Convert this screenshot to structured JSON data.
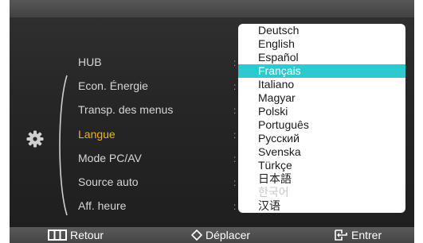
{
  "menu": {
    "items": [
      {
        "label": "HUB",
        "active": false
      },
      {
        "label": "Econ. Énergie",
        "active": false
      },
      {
        "label": "Transp. des menus",
        "active": false
      },
      {
        "label": "Langue",
        "active": true
      },
      {
        "label": "Mode PC/AV",
        "active": false
      },
      {
        "label": "Source auto",
        "active": false
      },
      {
        "label": "Aff. heure",
        "active": false
      }
    ],
    "separator": ":",
    "more_icon": "chevron-down-icon",
    "category_icon": "gear-icon"
  },
  "language_dropdown": {
    "selected": "Français",
    "options": [
      {
        "label": "Deutsch",
        "state": "normal"
      },
      {
        "label": "English",
        "state": "normal"
      },
      {
        "label": "Español",
        "state": "normal"
      },
      {
        "label": "Français",
        "state": "selected"
      },
      {
        "label": "Italiano",
        "state": "normal"
      },
      {
        "label": "Magyar",
        "state": "normal"
      },
      {
        "label": "Polski",
        "state": "normal"
      },
      {
        "label": "Português",
        "state": "normal"
      },
      {
        "label": "Русский",
        "state": "normal"
      },
      {
        "label": "Svenska",
        "state": "normal"
      },
      {
        "label": "Türkçe",
        "state": "normal"
      },
      {
        "label": "日本語",
        "state": "normal"
      },
      {
        "label": "한국어",
        "state": "disabled"
      },
      {
        "label": "汉语",
        "state": "normal"
      }
    ]
  },
  "footer": {
    "back_label": "Retour",
    "back_icon": "menu-button-icon",
    "move_label": "Déplacer",
    "move_icon": "up-down-arrows-icon",
    "enter_label": "Entrer",
    "enter_icon": "enter-source-icon"
  },
  "colors": {
    "active_menu": "#f5b400",
    "selection": "#2ec8cf",
    "panel": "#262626"
  }
}
